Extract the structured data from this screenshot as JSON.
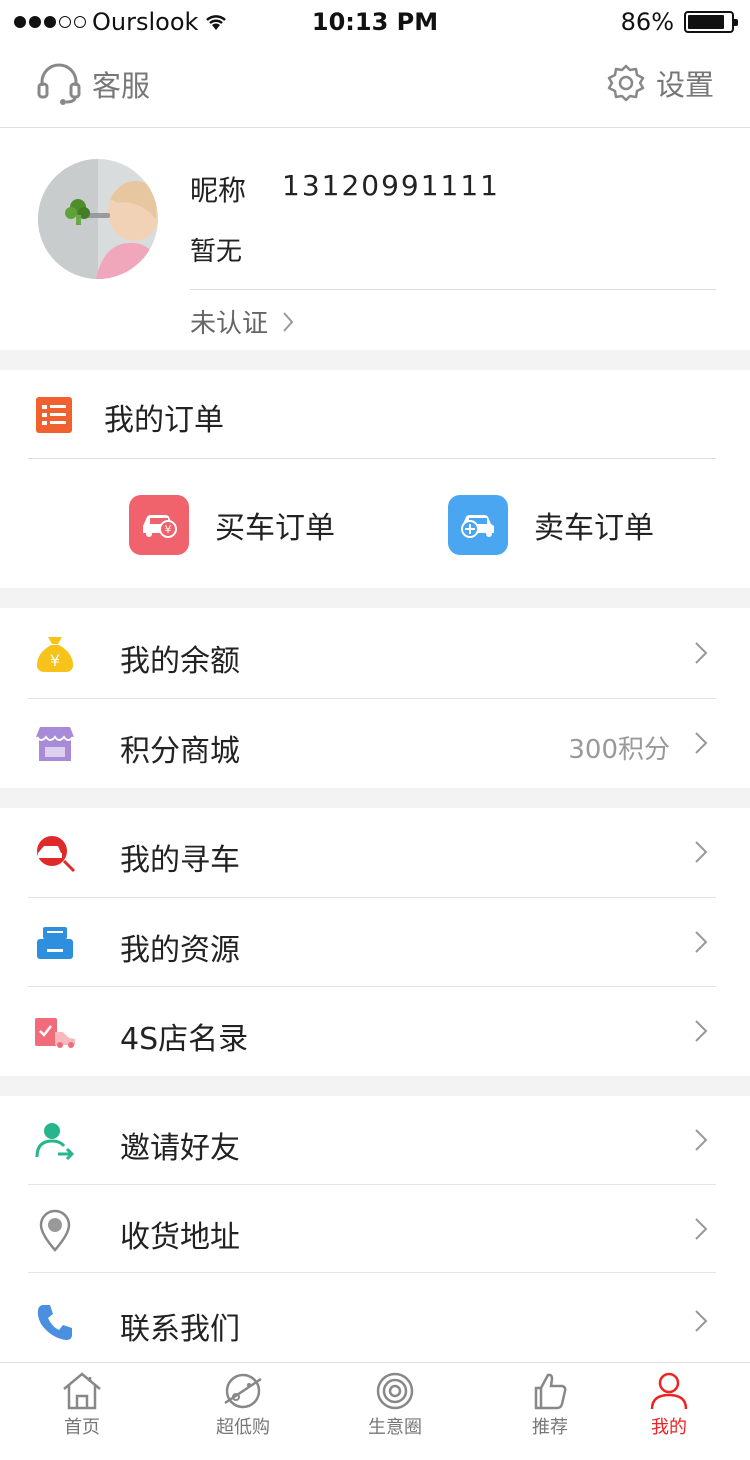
{
  "status_bar": {
    "carrier": "Ourslook",
    "time": "10:13 PM",
    "battery": "86%",
    "battery_level": 0.86
  },
  "header": {
    "service_label": "客服",
    "settings_label": "设置"
  },
  "profile": {
    "nickname_label": "昵称",
    "phone": "13120991111",
    "bio": "暂无",
    "verify_label": "未认证"
  },
  "orders": {
    "title": "我的订单",
    "buy_label": "买车订单",
    "sell_label": "卖车订单"
  },
  "menu": {
    "balance": "我的余额",
    "points_mall": "积分商城",
    "points_value": "300积分",
    "find_car": "我的寻车",
    "resources": "我的资源",
    "dealers": "4S店名录",
    "invite": "邀请好友",
    "address": "收货地址",
    "contact": "联系我们"
  },
  "tabbar": {
    "home": "首页",
    "deals": "超低购",
    "business": "生意圈",
    "recommend": "推荐",
    "mine": "我的"
  },
  "colors": {
    "accent": "#e22222",
    "buy_order": "#f0626c",
    "sell_order": "#4aa6f0",
    "orders_icon": "#f0612f"
  }
}
